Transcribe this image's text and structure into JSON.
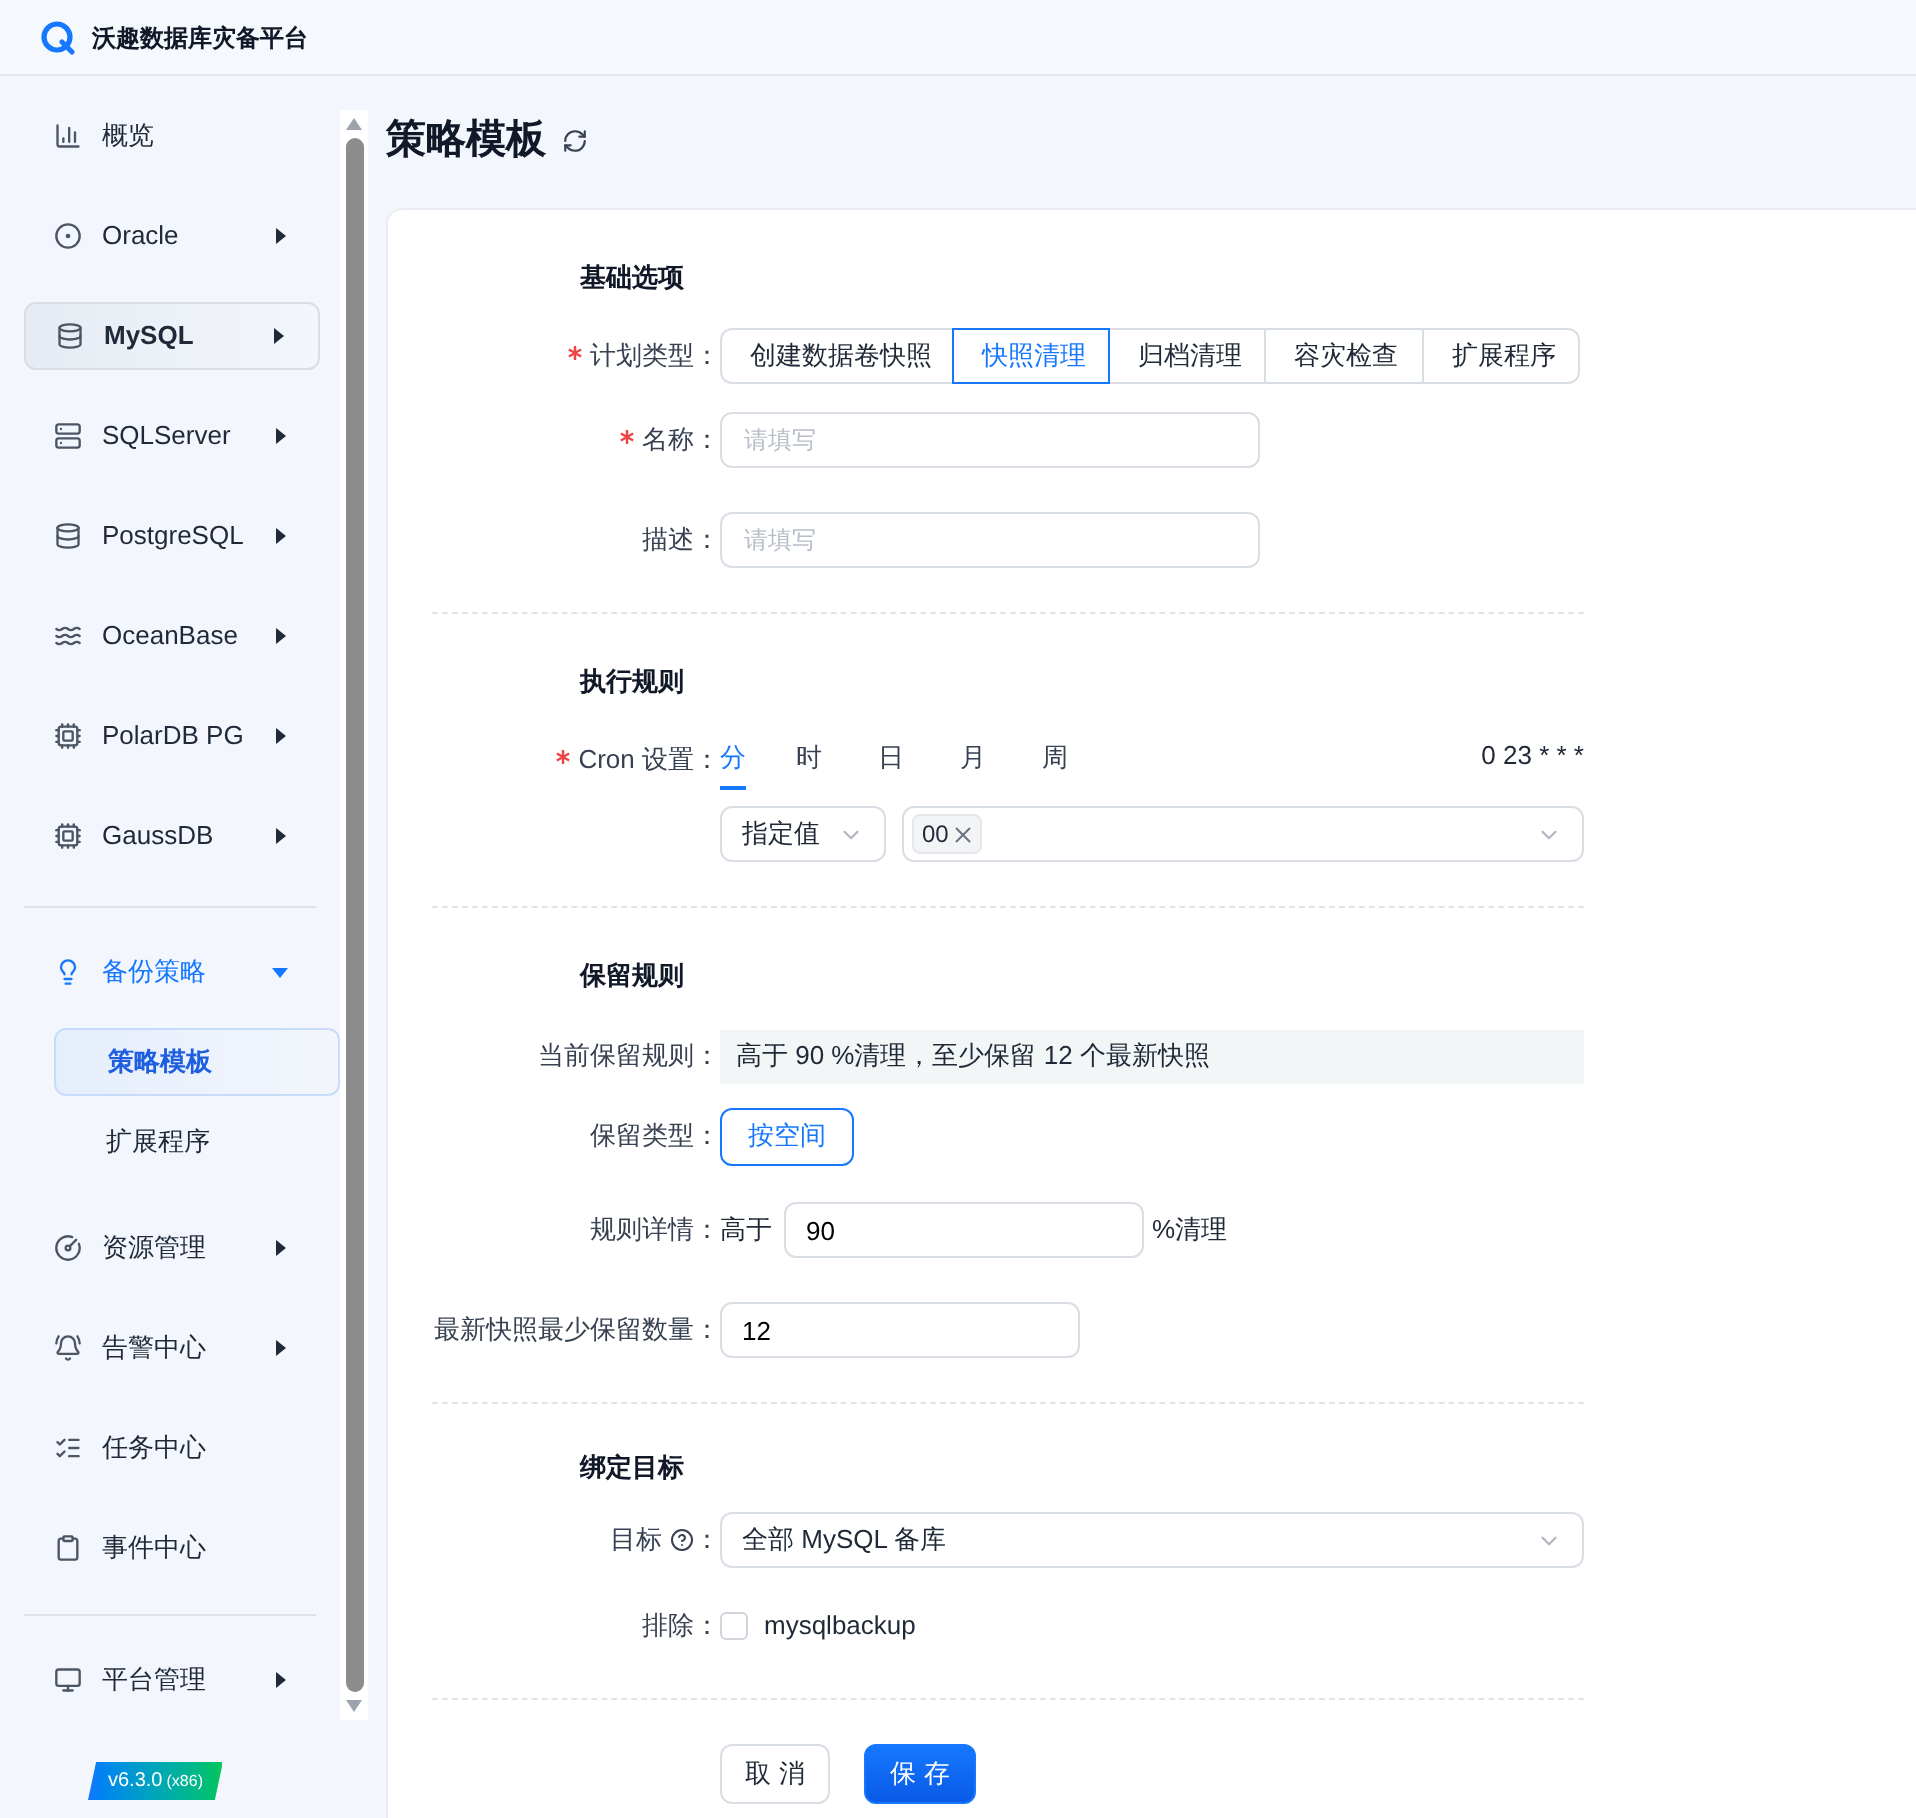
{
  "app": {
    "name": "沃趣数据库灾备平台"
  },
  "sidebar": {
    "groups": [
      [
        {
          "label": "概览",
          "selected": false,
          "has_submenu": false
        },
        {
          "label": "Oracle",
          "selected": false,
          "has_submenu": true,
          "expanded": false
        },
        {
          "label": "MySQL",
          "selected": true,
          "has_submenu": true,
          "expanded": false
        },
        {
          "label": "SQLServer",
          "selected": false,
          "has_submenu": true,
          "expanded": false
        },
        {
          "label": "PostgreSQL",
          "selected": false,
          "has_submenu": true,
          "expanded": false
        },
        {
          "label": "OceanBase",
          "selected": false,
          "has_submenu": true,
          "expanded": false
        },
        {
          "label": "PolarDB PG",
          "selected": false,
          "has_submenu": true,
          "expanded": false
        },
        {
          "label": "GaussDB",
          "selected": false,
          "has_submenu": true,
          "expanded": false
        }
      ],
      [
        {
          "label": "备份策略",
          "selected": false,
          "has_submenu": true,
          "expanded": true,
          "children": [
            {
              "label": "策略模板",
              "selected": true
            },
            {
              "label": "扩展程序",
              "selected": false
            }
          ]
        },
        {
          "label": "资源管理",
          "selected": false,
          "has_submenu": true,
          "expanded": false
        },
        {
          "label": "告警中心",
          "selected": false,
          "has_submenu": true,
          "expanded": false
        },
        {
          "label": "任务中心",
          "selected": false,
          "has_submenu": false
        },
        {
          "label": "事件中心",
          "selected": false,
          "has_submenu": false
        }
      ],
      [
        {
          "label": "平台管理",
          "selected": false,
          "has_submenu": true,
          "expanded": false
        }
      ]
    ],
    "version": "v6.3.0",
    "arch": "(x86)"
  },
  "page": {
    "title": "策略模板"
  },
  "basic": {
    "heading": "基础选项",
    "plan_type": {
      "label": "计划类型：",
      "required": true,
      "options": [
        {
          "label": "创建数据卷快照",
          "selected": false
        },
        {
          "label": "快照清理",
          "selected": true
        },
        {
          "label": "归档清理",
          "selected": false
        },
        {
          "label": "容灾检查",
          "selected": false
        },
        {
          "label": "扩展程序",
          "selected": false
        }
      ]
    },
    "name": {
      "label": "名称：",
      "required": true,
      "placeholder": "请填写"
    },
    "description": {
      "label": "描述：",
      "required": false,
      "placeholder": "请填写"
    }
  },
  "execution": {
    "heading": "执行规则",
    "cron": {
      "label": "Cron 设置：",
      "required": true,
      "units": [
        {
          "label": "分",
          "selected": true
        },
        {
          "label": "时",
          "selected": false
        },
        {
          "label": "日",
          "selected": false
        },
        {
          "label": "月",
          "selected": false
        },
        {
          "label": "周",
          "selected": false
        }
      ],
      "expression": "0 23 * * *",
      "mode": "指定值",
      "tags": [
        "00"
      ]
    }
  },
  "retention": {
    "heading": "保留规则",
    "current": {
      "label": "当前保留规则：",
      "value": "高于 90 %清理，至少保留 12 个最新快照"
    },
    "type": {
      "label": "保留类型：",
      "options": [
        {
          "label": "按空间",
          "selected": true
        }
      ]
    },
    "detail": {
      "label": "规则详情：",
      "prefix": "高于",
      "value": "90",
      "suffix": "%清理"
    },
    "min_keep": {
      "label": "最新快照最少保留数量：",
      "value": "12"
    }
  },
  "binding": {
    "heading": "绑定目标",
    "target": {
      "label": "目标",
      "label_suffix": "：",
      "value": "全部 MySQL 备库"
    },
    "exclude": {
      "label": "排除：",
      "options": [
        {
          "label": "mysqlbackup",
          "checked": false
        }
      ]
    }
  },
  "actions": [
    {
      "label": "取 消",
      "kind": "secondary"
    },
    {
      "label": "保 存",
      "kind": "primary"
    }
  ]
}
